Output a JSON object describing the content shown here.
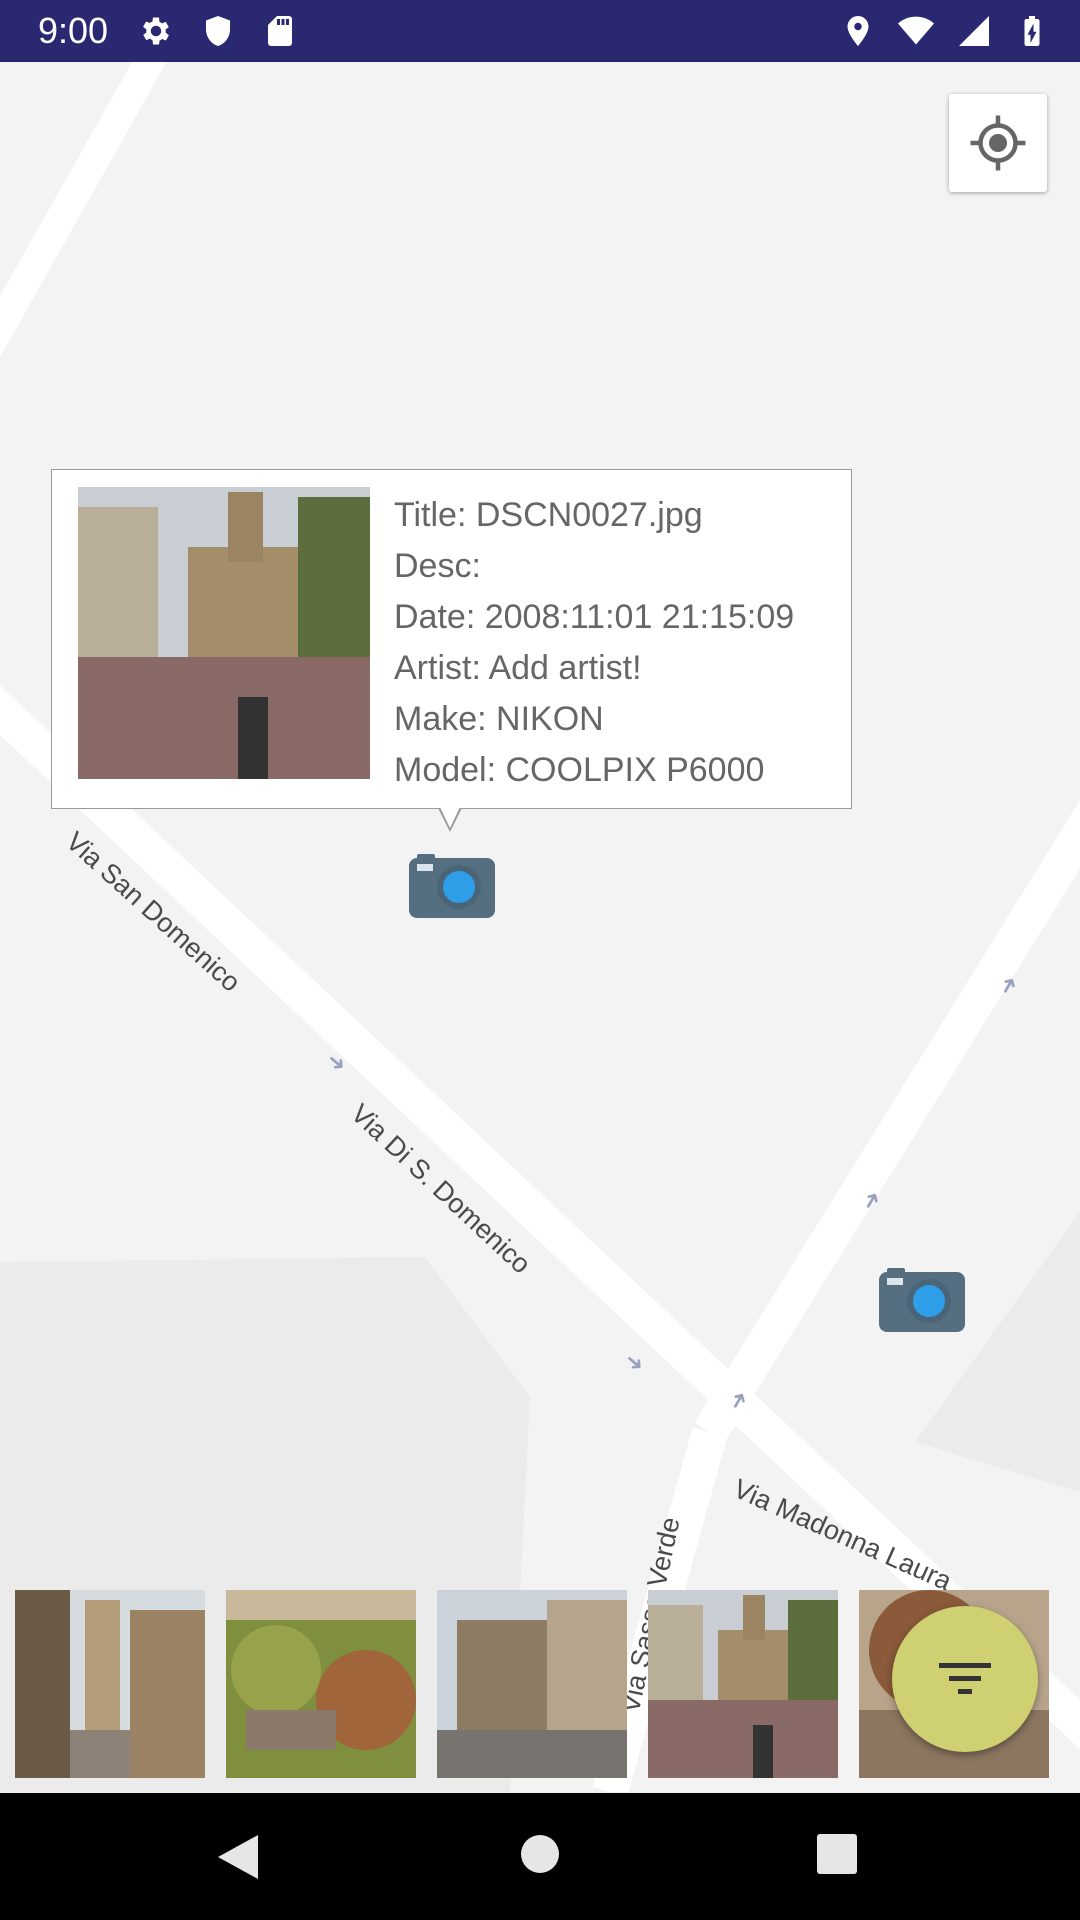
{
  "status_bar": {
    "time": "9:00",
    "left_icons": [
      "gear-icon",
      "shield-icon",
      "sd-card-icon"
    ],
    "right_icons": [
      "location-pin-icon",
      "wifi-icon",
      "signal-icon",
      "battery-charging-icon"
    ],
    "background": "#2a2870"
  },
  "map": {
    "street_labels": [
      "Via San Domenico",
      "Via Di S. Domenico",
      "Via Madonna Laura",
      "Via Sasso Verde"
    ]
  },
  "popup": {
    "title": "Title: DSCN0027.jpg",
    "desc": "Desc:",
    "date": "Date: 2008:11:01 21:15:09",
    "artist": "Artist: Add artist!",
    "make": "Make: NIKON",
    "model": "Model: COOLPIX P6000"
  },
  "thumbnails": [
    "tower-street-photo",
    "garden-photo",
    "church-square-photo",
    "church-plaza-photo",
    "autumn-tree-photo"
  ],
  "fab": {
    "icon": "filter-icon",
    "color": "#cfd071"
  },
  "nav_bar": {
    "buttons": [
      "back",
      "home",
      "recents"
    ]
  }
}
